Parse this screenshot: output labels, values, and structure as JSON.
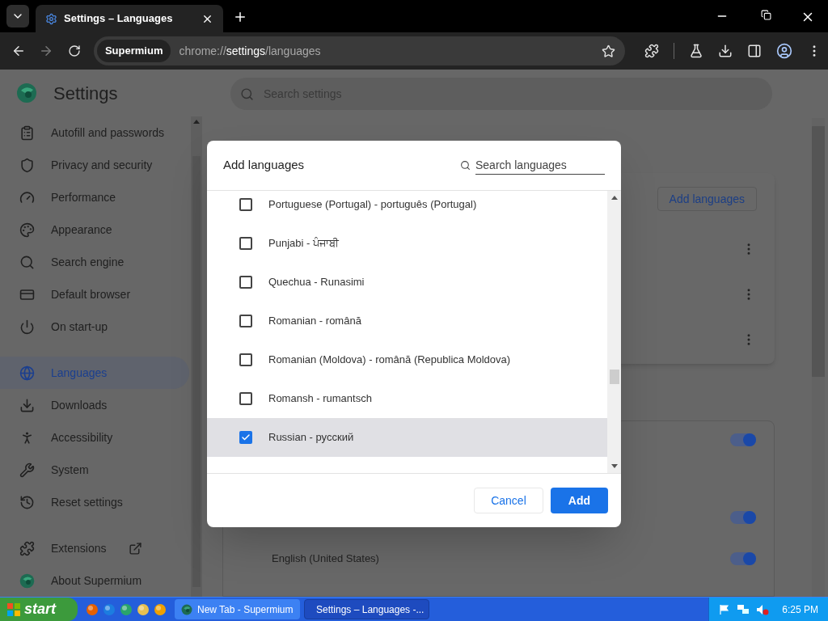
{
  "browser": {
    "tabs": [
      {
        "title": "Settings – Languages",
        "selected": true
      }
    ],
    "address": {
      "chip": "Supermium",
      "scheme": "chrome://",
      "host": "settings",
      "path": "/languages"
    }
  },
  "settings": {
    "title": "Settings",
    "search_placeholder": "Search settings",
    "sidebar": [
      {
        "label": "Autofill and passwords",
        "selected": false
      },
      {
        "label": "Privacy and security",
        "selected": false
      },
      {
        "label": "Performance",
        "selected": false
      },
      {
        "label": "Appearance",
        "selected": false
      },
      {
        "label": "Search engine",
        "selected": false
      },
      {
        "label": "Default browser",
        "selected": false
      },
      {
        "label": "On start-up",
        "selected": false
      },
      {
        "label": "Languages",
        "selected": true
      },
      {
        "label": "Downloads",
        "selected": false
      },
      {
        "label": "Accessibility",
        "selected": false
      },
      {
        "label": "System",
        "selected": false
      },
      {
        "label": "Reset settings",
        "selected": false
      },
      {
        "label": "Extensions",
        "selected": false
      },
      {
        "label": "About Supermium",
        "selected": false
      }
    ],
    "add_languages_button": "Add languages",
    "toggles": [
      {
        "on": true
      },
      {
        "on": true
      },
      {
        "on": true
      }
    ],
    "language_label": "English (United States)"
  },
  "dialog": {
    "title": "Add languages",
    "search_placeholder": "Search languages",
    "languages": [
      {
        "label": "Portuguese (Portugal) - português (Portugal)",
        "checked": false
      },
      {
        "label": "Punjabi - ਪੰਜਾਬੀ",
        "checked": false
      },
      {
        "label": "Quechua - Runasimi",
        "checked": false
      },
      {
        "label": "Romanian - română",
        "checked": false
      },
      {
        "label": "Romanian (Moldova) - română (Republica Moldova)",
        "checked": false
      },
      {
        "label": "Romansh - rumantsch",
        "checked": false
      },
      {
        "label": "Russian - русский",
        "checked": true
      }
    ],
    "buttons": [
      {
        "label": "Cancel",
        "kind": "secondary"
      },
      {
        "label": "Add",
        "kind": "primary"
      }
    ]
  },
  "taskbar": {
    "start": "start",
    "tasks": [
      {
        "title": "New Tab - Supermium",
        "selected": false
      },
      {
        "title": "Settings – Languages -...",
        "selected": true
      }
    ],
    "time": "6:25 PM"
  }
}
